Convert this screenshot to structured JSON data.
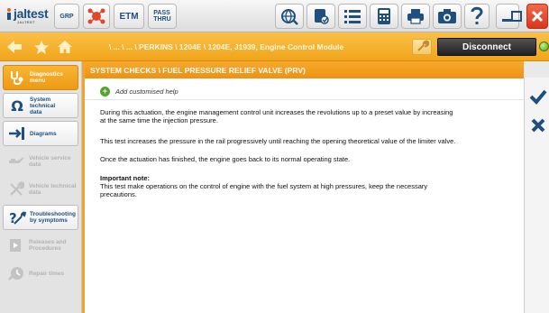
{
  "toolbar": {
    "logo": "jaltest",
    "logo_sub": "JALTEST",
    "gbtn": "GRP",
    "etm": "ETM",
    "pass_line1": "PASS",
    "pass_line2": "THRU"
  },
  "nav": {
    "breadcrumb": "\\ ... \\ ... \\ PERKINS \\ 1204E \\ 1204E, J1939, Engine Control Module",
    "disconnect": "Disconnect"
  },
  "sidebar": {
    "items": [
      {
        "label1": "Diagnostics",
        "label2": "menu"
      },
      {
        "label1": "System technical",
        "label2": "data"
      },
      {
        "label1": "Diagrams",
        "label2": ""
      },
      {
        "label1": "Vehicle service",
        "label2": "data"
      },
      {
        "label1": "Vehicle technical",
        "label2": "data"
      },
      {
        "label1": "Troubleshooting",
        "label2": "by symptoms"
      },
      {
        "label1": "Releases and",
        "label2": "Procedures"
      },
      {
        "label1": "Repair times",
        "label2": ""
      }
    ]
  },
  "content": {
    "title": "SYSTEM CHECKS \\ FUEL PRESSURE RELIEF VALVE (PRV)",
    "add_help": "Add customised help",
    "p1_line1": "During this actuation, the engine management control unit increases the revolutions up to a preset value by increasing",
    "p1_line2": "at the same time the injection pressure.",
    "p2": "This test increases the pressure in the rail progressively until reaching the opening theoretical value of the limiter valve.",
    "p3": "Once the actuation has finished, the engine goes back to its normal operating state.",
    "note_title": "Important note",
    "note_line1": "This test make operations on the control of engine with the fuel system at high pressures, keep the necessary",
    "note_line2": "precautions."
  },
  "colors": {
    "accent_orange": "#f3a42a",
    "brand_blue": "#1f4f7f",
    "close_red": "#e0472a",
    "status_green": "#53a62b"
  }
}
